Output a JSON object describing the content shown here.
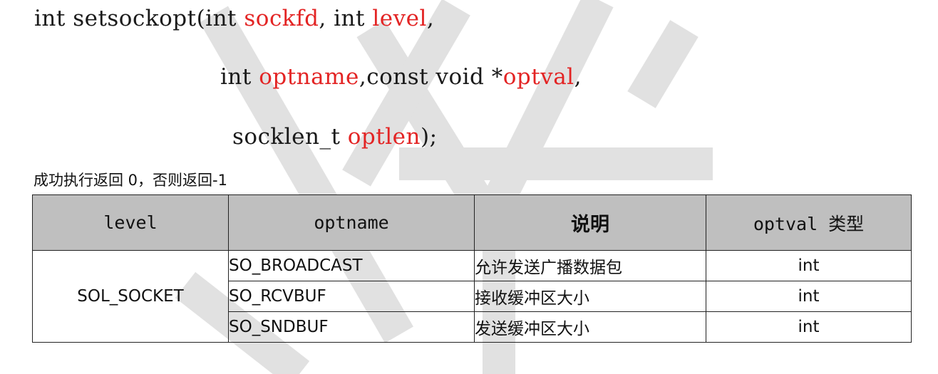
{
  "signature": {
    "line1": {
      "prefix": "int setsockopt(int ",
      "param1": "sockfd",
      "mid": ", int ",
      "param2": "level",
      "suffix": ","
    },
    "line2": {
      "prefix": "int ",
      "param1": "optname",
      "mid": ",const void *",
      "param2": "optval",
      "suffix": ","
    },
    "line3": {
      "prefix": "socklen_t ",
      "param1": "optlen",
      "suffix": ");"
    }
  },
  "return_note": "成功执行返回 0，否则返回-1",
  "table": {
    "headers": [
      "level",
      "optname",
      "说明",
      "optval 类型"
    ],
    "level_value": "SOL_SOCKET",
    "rows": [
      {
        "optname": "SO_BROADCAST",
        "desc": "允许发送广播数据包",
        "type": "int"
      },
      {
        "optname": "SO_RCVBUF",
        "desc": "接收缓冲区大小",
        "type": "int"
      },
      {
        "optname": "SO_SNDBUF",
        "desc": "发送缓冲区大小",
        "type": "int"
      }
    ]
  },
  "colors": {
    "param": "#e32424",
    "header_bg": "#bfbfbf",
    "watermark": "#d9d9d9"
  }
}
